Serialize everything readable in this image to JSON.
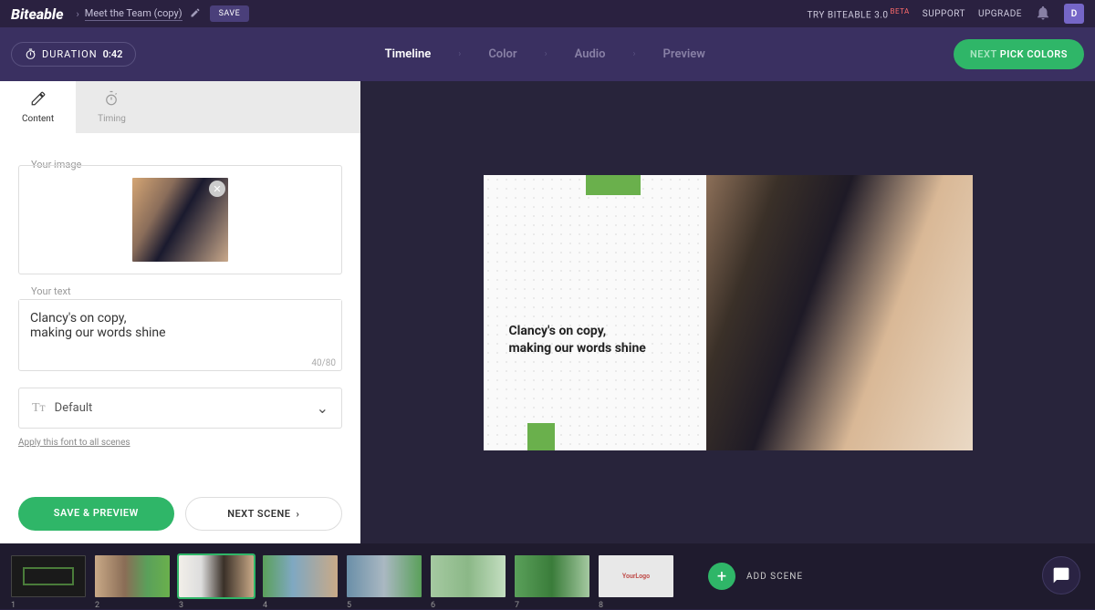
{
  "header": {
    "logo": "Biteable",
    "project_title": "Meet the Team (copy)",
    "save": "SAVE",
    "try_v3": "TRY BITEABLE 3.0",
    "beta": "BETA",
    "support": "SUPPORT",
    "upgrade": "UPGRADE",
    "user_initial": "D"
  },
  "subheader": {
    "duration_label": "DURATION",
    "duration_value": "0:42",
    "steps": [
      "Timeline",
      "Color",
      "Audio",
      "Preview"
    ],
    "active_step": "Timeline",
    "next_prefix": "NEXT",
    "next_label": "PICK COLORS"
  },
  "sidebar": {
    "tabs": {
      "content": "Content",
      "timing": "Timing"
    },
    "image_label": "Your image",
    "text_label": "Your text",
    "text_value": "Clancy's on copy,\nmaking our words shine",
    "char_count": "40",
    "char_max": "/80",
    "font_label": "Default",
    "apply_font": "Apply this font to all scenes",
    "save_preview": "SAVE & PREVIEW",
    "next_scene": "NEXT SCENE"
  },
  "scene": {
    "text": "Clancy's on copy,\nmaking our words shine"
  },
  "timeline": {
    "add_scene": "ADD SCENE",
    "count": 8
  }
}
